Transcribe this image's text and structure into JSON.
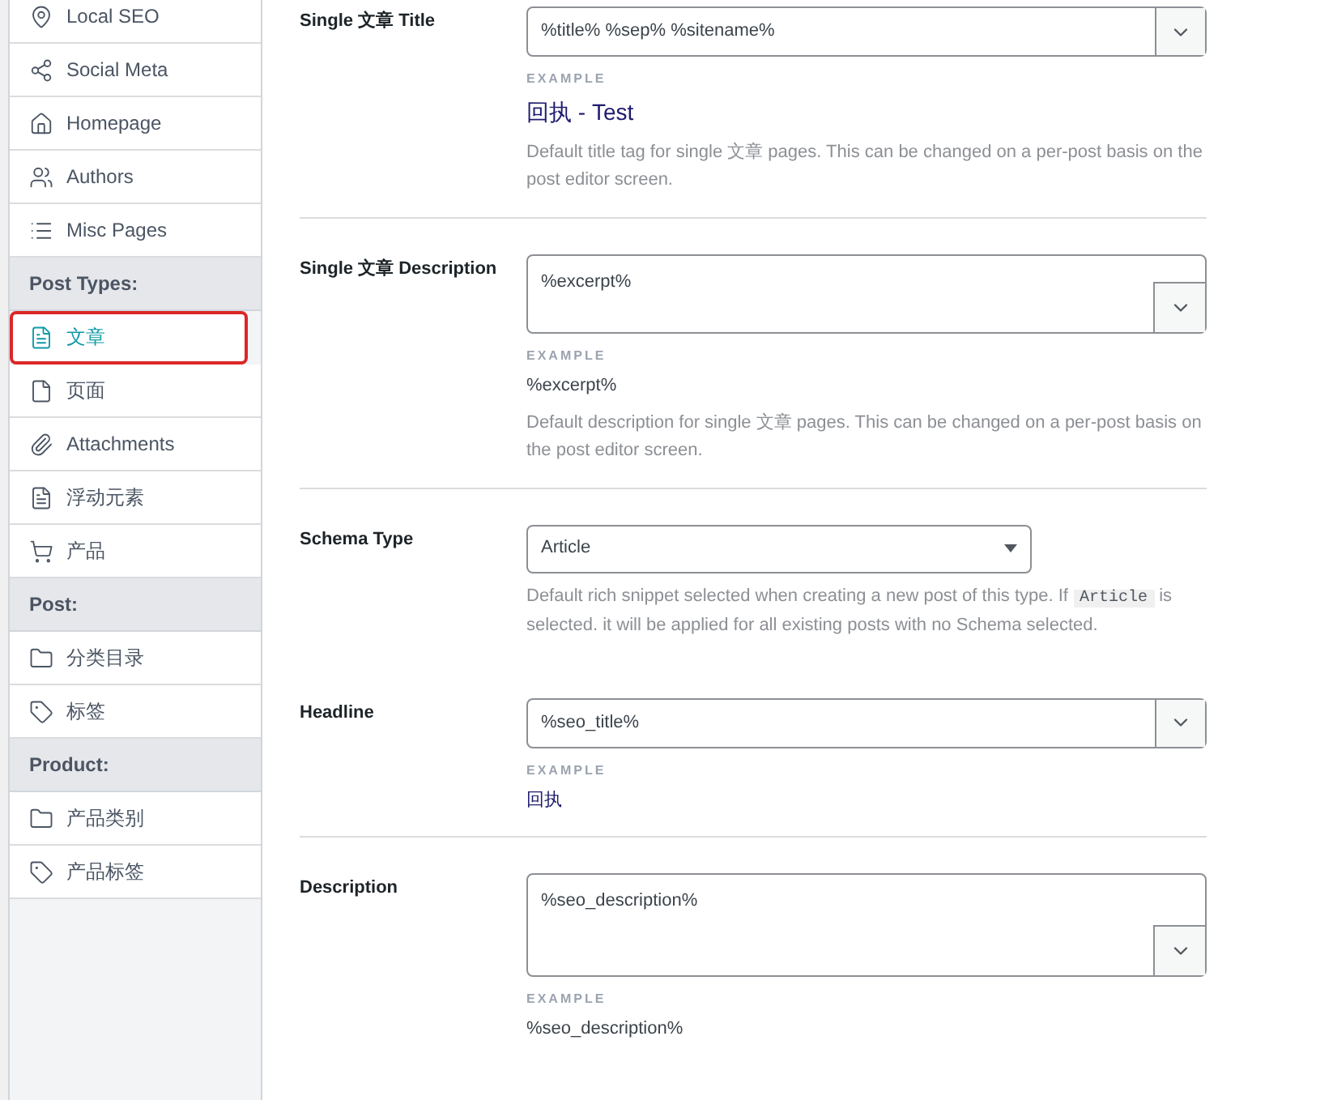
{
  "sidebar": {
    "items": [
      {
        "kind": "item",
        "label": "Local SEO",
        "selected": false
      },
      {
        "kind": "item",
        "label": "Social Meta",
        "selected": false
      },
      {
        "kind": "item",
        "label": "Homepage",
        "selected": false
      },
      {
        "kind": "item",
        "label": "Authors",
        "selected": false
      },
      {
        "kind": "item",
        "label": "Misc Pages",
        "selected": false
      },
      {
        "kind": "header",
        "label": "Post Types:"
      },
      {
        "kind": "item",
        "label": "文章",
        "selected": true
      },
      {
        "kind": "item",
        "label": "页面",
        "selected": false
      },
      {
        "kind": "item",
        "label": "Attachments",
        "selected": false
      },
      {
        "kind": "item",
        "label": "浮动元素",
        "selected": false
      },
      {
        "kind": "item",
        "label": "产品",
        "selected": false
      },
      {
        "kind": "header",
        "label": "Post:"
      },
      {
        "kind": "item",
        "label": "分类目录",
        "selected": false
      },
      {
        "kind": "item",
        "label": "标签",
        "selected": false
      },
      {
        "kind": "header",
        "label": "Product:"
      },
      {
        "kind": "item",
        "label": "产品类别",
        "selected": false
      },
      {
        "kind": "item",
        "label": "产品标签",
        "selected": false
      }
    ]
  },
  "settings": [
    {
      "label": "Single 文章 Title",
      "field": {
        "kind": "input",
        "value": "%title% %sep% %sitename%"
      },
      "example": {
        "heading": "EXAMPLE",
        "kind": "title",
        "text": "回执 - Test"
      },
      "help": [
        {
          "kind": "text",
          "text": "Default title tag for single 文章 pages. This can be changed on a per-post basis on the post editor screen."
        }
      ]
    },
    {
      "label": "Single 文章 Description",
      "field": {
        "kind": "textarea",
        "value": "%excerpt%"
      },
      "example": {
        "heading": "EXAMPLE",
        "kind": "text",
        "text": "%excerpt%"
      },
      "help": [
        {
          "kind": "text",
          "text": "Default description for single 文章 pages. This can be changed on a per-post basis on the post editor screen."
        }
      ]
    },
    {
      "label": "Schema Type",
      "field": {
        "kind": "select",
        "value": "Article"
      },
      "help": [
        {
          "kind": "text",
          "text": "Default rich snippet selected when creating a new post of this type. If "
        },
        {
          "kind": "code",
          "text": "Article"
        },
        {
          "kind": "text",
          "text": " is selected. it will be applied for all existing posts with no Schema selected."
        }
      ]
    },
    {
      "label": "Headline",
      "field": {
        "kind": "input",
        "value": "%seo_title%"
      },
      "example": {
        "heading": "EXAMPLE",
        "kind": "link",
        "text": "回执"
      }
    },
    {
      "label": "Description",
      "field": {
        "kind": "textarea",
        "value": "%seo_description%"
      },
      "example": {
        "heading": "EXAMPLE",
        "kind": "text",
        "text": "%seo_description%"
      }
    }
  ]
}
